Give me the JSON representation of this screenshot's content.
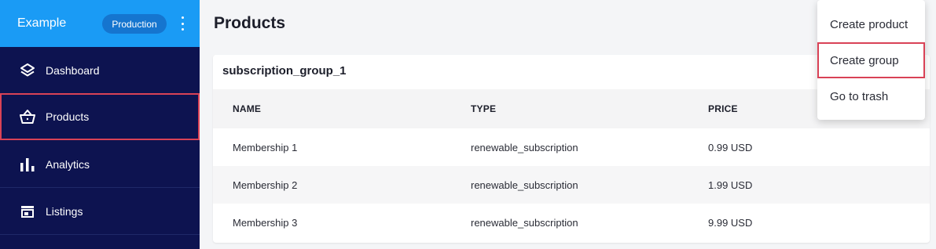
{
  "sidebar": {
    "app_name": "Example",
    "environment": "Production",
    "items": [
      {
        "label": "Dashboard",
        "icon": "layers-icon"
      },
      {
        "label": "Products",
        "icon": "basket-icon",
        "active": true
      },
      {
        "label": "Analytics",
        "icon": "bar-chart-icon"
      },
      {
        "label": "Listings",
        "icon": "storefront-icon"
      }
    ]
  },
  "main": {
    "title": "Products",
    "group": {
      "name": "subscription_group_1",
      "columns": [
        "NAME",
        "TYPE",
        "PRICE"
      ],
      "rows": [
        [
          "Membership 1",
          "renewable_subscription",
          "0.99 USD"
        ],
        [
          "Membership 2",
          "renewable_subscription",
          "1.99 USD"
        ],
        [
          "Membership 3",
          "renewable_subscription",
          "9.99 USD"
        ]
      ]
    }
  },
  "menu": {
    "items": [
      "Create product",
      "Create group",
      "Go to trash"
    ]
  },
  "colors": {
    "sidebar_bg": "#0d1350",
    "header_bg": "#1a9bf5",
    "highlight_border": "#d94256"
  }
}
